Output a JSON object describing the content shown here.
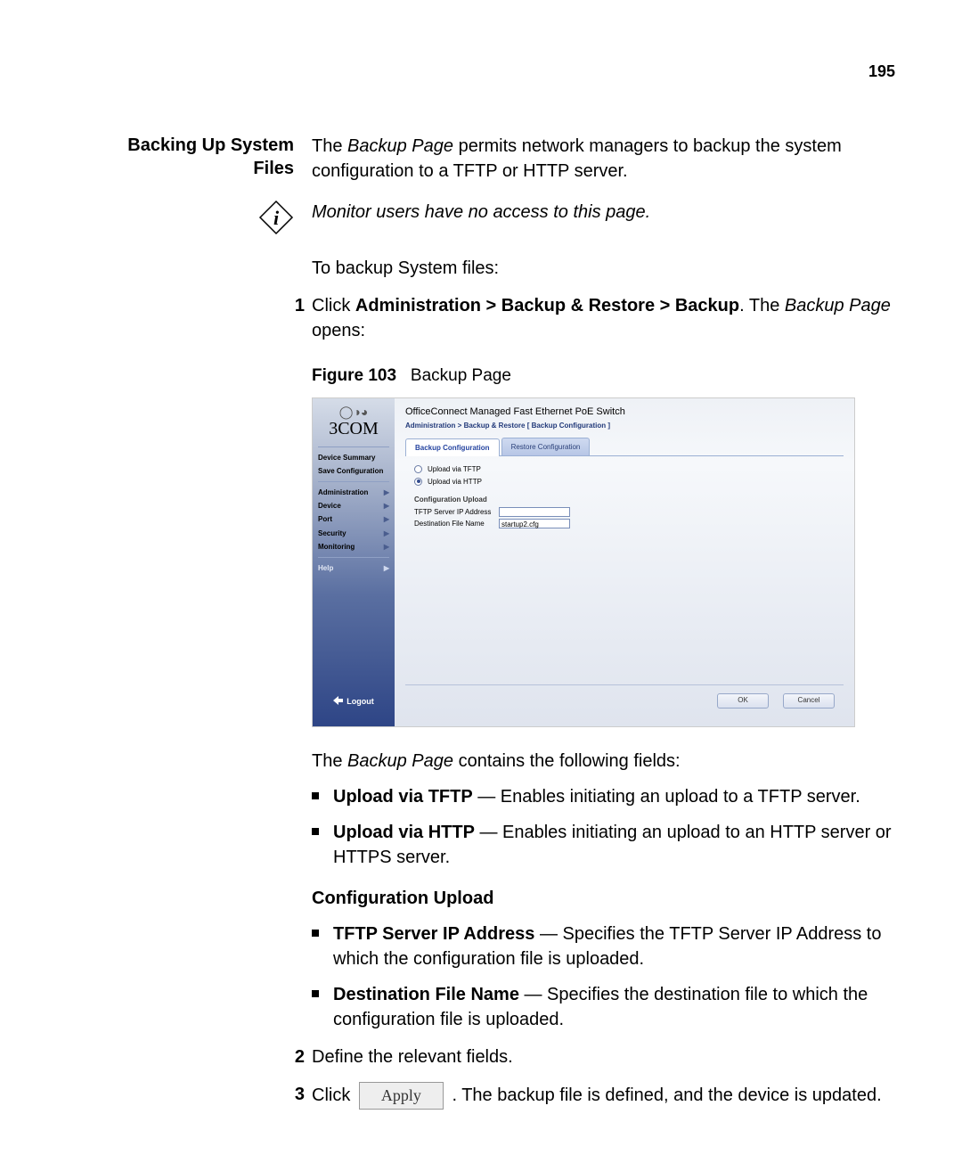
{
  "page_number": "195",
  "section_title_line1": "Backing Up System",
  "section_title_line2": "Files",
  "intro_a": "The ",
  "intro_b_italic": "Backup Page",
  "intro_c": " permits network managers to backup the system configuration to a TFTP or HTTP server.",
  "note_italic": "Monitor users have no access to this page.",
  "to_backup": "To backup System files:",
  "step1_a": "Click ",
  "step1_b_bold": "Administration > Backup & Restore > Backup",
  "step1_c": ". The ",
  "step1_d_italic": "Backup Page",
  "step1_e": " opens:",
  "figure_label": "Figure 103",
  "figure_caption": "Backup Page",
  "screenshot": {
    "logo_text": "3COM",
    "title": "OfficeConnect Managed Fast Ethernet PoE Switch",
    "breadcrumb": "Administration > Backup & Restore [ Backup Configuration ]",
    "tab_active": "Backup Configuration",
    "tab_inactive": "Restore Configuration",
    "radio_tftp": "Upload via TFTP",
    "radio_http": "Upload via HTTP",
    "config_upload": "Configuration Upload",
    "field_ip": "TFTP Server IP Address",
    "field_file": "Destination File Name",
    "file_value": "startup2.cfg",
    "ok": "OK",
    "cancel": "Cancel",
    "nav": {
      "device_summary": "Device Summary",
      "save_config": "Save Configuration",
      "administration": "Administration",
      "device": "Device",
      "port": "Port",
      "security": "Security",
      "monitoring": "Monitoring",
      "help": "Help"
    },
    "logout": "Logout"
  },
  "after_fig_a": "The ",
  "after_fig_b_italic": "Backup Page",
  "after_fig_c": " contains the following fields:",
  "bullet1_b": "Upload via TFTP",
  "bullet1_t": " — Enables initiating an upload to a TFTP server.",
  "bullet2_b": "Upload via HTTP",
  "bullet2_t": " — Enables initiating an upload to an HTTP server or HTTPS server.",
  "subhead": "Configuration Upload",
  "bullet3_b": "TFTP Server IP Address",
  "bullet3_t": " — Specifies the TFTP Server IP Address to which the configuration file is uploaded.",
  "bullet4_b": "Destination File Name",
  "bullet4_t": " — Specifies the destination file to which the configuration file is uploaded.",
  "step2": "Define the relevant fields.",
  "step3_a": "Click ",
  "apply_label": "Apply",
  "step3_b": ". The backup file is defined, and the device is updated."
}
